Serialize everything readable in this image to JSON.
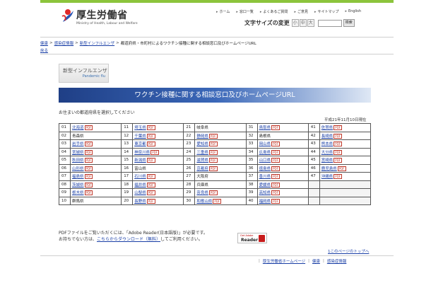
{
  "header": {
    "title": "厚生労働省",
    "subtitle": "Ministry of Health, Labour and Welfare",
    "top_links": [
      "ホーム",
      "窓口一覧",
      "よくあるご質問",
      "ご意見",
      "サイトマップ",
      "English"
    ],
    "font_size_label": "文字サイズの変更",
    "font_sizes": [
      "小",
      "中",
      "大"
    ],
    "search_button": "検索"
  },
  "breadcrumb": [
    "健康",
    "感染症情報",
    "新型インフルエンザ",
    "都道府県・市町村によるワクチン接種に関する相談窓口及びホームページURL"
  ],
  "back_link": "戻る",
  "banner": {
    "title": "新型インフルエンザ",
    "subtitle": "Pandemic flu"
  },
  "page_title": "ワクチン接種に関する相談窓口及びホームページURL",
  "instruction": "お住まいの都道府県を選択してください",
  "date": "平成21年11月10日現在",
  "pdf_label": "PDF",
  "prefectures": [
    [
      {
        "n": "01",
        "name": "北海道",
        "link": true,
        "pdf": true
      },
      {
        "n": "11",
        "name": "埼玉県",
        "link": true,
        "pdf": true
      },
      {
        "n": "21",
        "name": "岐阜県",
        "link": false,
        "pdf": false
      },
      {
        "n": "31",
        "name": "鳥取県",
        "link": true,
        "pdf": true
      },
      {
        "n": "41",
        "name": "佐賀県",
        "link": true,
        "pdf": true
      }
    ],
    [
      {
        "n": "02",
        "name": "青森県",
        "link": false,
        "pdf": false
      },
      {
        "n": "12",
        "name": "千葉県",
        "link": true,
        "pdf": true
      },
      {
        "n": "22",
        "name": "静岡県",
        "link": true,
        "pdf": true
      },
      {
        "n": "32",
        "name": "島根県",
        "link": false,
        "pdf": false
      },
      {
        "n": "42",
        "name": "長崎県",
        "link": true,
        "pdf": true
      }
    ],
    [
      {
        "n": "03",
        "name": "岩手県",
        "link": true,
        "pdf": true
      },
      {
        "n": "13",
        "name": "東京都",
        "link": true,
        "pdf": true
      },
      {
        "n": "23",
        "name": "愛知県",
        "link": true,
        "pdf": true
      },
      {
        "n": "33",
        "name": "岡山県",
        "link": true,
        "pdf": true
      },
      {
        "n": "43",
        "name": "熊本県",
        "link": true,
        "pdf": true
      }
    ],
    [
      {
        "n": "04",
        "name": "宮城県",
        "link": true,
        "pdf": true
      },
      {
        "n": "14",
        "name": "神奈川県",
        "link": true,
        "pdf": true
      },
      {
        "n": "24",
        "name": "三重県",
        "link": true,
        "pdf": true
      },
      {
        "n": "34",
        "name": "広島県",
        "link": true,
        "pdf": true
      },
      {
        "n": "44",
        "name": "大分県",
        "link": true,
        "pdf": true
      }
    ],
    [
      {
        "n": "05",
        "name": "秋田県",
        "link": true,
        "pdf": true
      },
      {
        "n": "15",
        "name": "新潟県",
        "link": true,
        "pdf": true
      },
      {
        "n": "25",
        "name": "滋賀県",
        "link": true,
        "pdf": true
      },
      {
        "n": "35",
        "name": "山口県",
        "link": true,
        "pdf": true
      },
      {
        "n": "45",
        "name": "宮崎県",
        "link": true,
        "pdf": true
      }
    ],
    [
      {
        "n": "06",
        "name": "山形県",
        "link": true,
        "pdf": true
      },
      {
        "n": "16",
        "name": "富山県",
        "link": false,
        "pdf": false
      },
      {
        "n": "26",
        "name": "京都府",
        "link": true,
        "pdf": true
      },
      {
        "n": "36",
        "name": "徳島県",
        "link": true,
        "pdf": true
      },
      {
        "n": "46",
        "name": "鹿児島県",
        "link": true,
        "pdf": true
      }
    ],
    [
      {
        "n": "07",
        "name": "福島県",
        "link": true,
        "pdf": true
      },
      {
        "n": "17",
        "name": "石川県",
        "link": true,
        "pdf": true
      },
      {
        "n": "27",
        "name": "大阪府",
        "link": false,
        "pdf": false
      },
      {
        "n": "37",
        "name": "香川県",
        "link": true,
        "pdf": true
      },
      {
        "n": "47",
        "name": "沖縄県",
        "link": true,
        "pdf": true
      }
    ],
    [
      {
        "n": "08",
        "name": "茨城県",
        "link": true,
        "pdf": true
      },
      {
        "n": "18",
        "name": "福井県",
        "link": true,
        "pdf": true
      },
      {
        "n": "28",
        "name": "兵庫県",
        "link": false,
        "pdf": false
      },
      {
        "n": "38",
        "name": "愛媛県",
        "link": true,
        "pdf": true
      },
      null
    ],
    [
      {
        "n": "09",
        "name": "栃木県",
        "link": true,
        "pdf": true
      },
      {
        "n": "19",
        "name": "山梨県",
        "link": true,
        "pdf": true
      },
      {
        "n": "29",
        "name": "奈良県",
        "link": true,
        "pdf": true
      },
      {
        "n": "39",
        "name": "高知県",
        "link": true,
        "pdf": true
      },
      null
    ],
    [
      {
        "n": "10",
        "name": "群馬県",
        "link": false,
        "pdf": false
      },
      {
        "n": "20",
        "name": "長野県",
        "link": true,
        "pdf": true
      },
      {
        "n": "30",
        "name": "和歌山県",
        "link": true,
        "pdf": true
      },
      {
        "n": "40",
        "name": "福岡県",
        "link": true,
        "pdf": true
      },
      null
    ]
  ],
  "pdf_note": {
    "line1": "PDFファイルをご覧いただくには、「Adobe Reader(日本語版)」が必要です。",
    "line2_prefix": "お持ちでない方は、",
    "line2_link": "こちらからダウンロード（無料）",
    "line2_suffix": "してご利用ください。"
  },
  "reader_badge": {
    "top": "Get Adobe",
    "main": "Reader"
  },
  "to_top": "1このページのトップへ",
  "footer_links": [
    "厚生労働省ホームページ",
    "健康",
    "感染症情報"
  ]
}
